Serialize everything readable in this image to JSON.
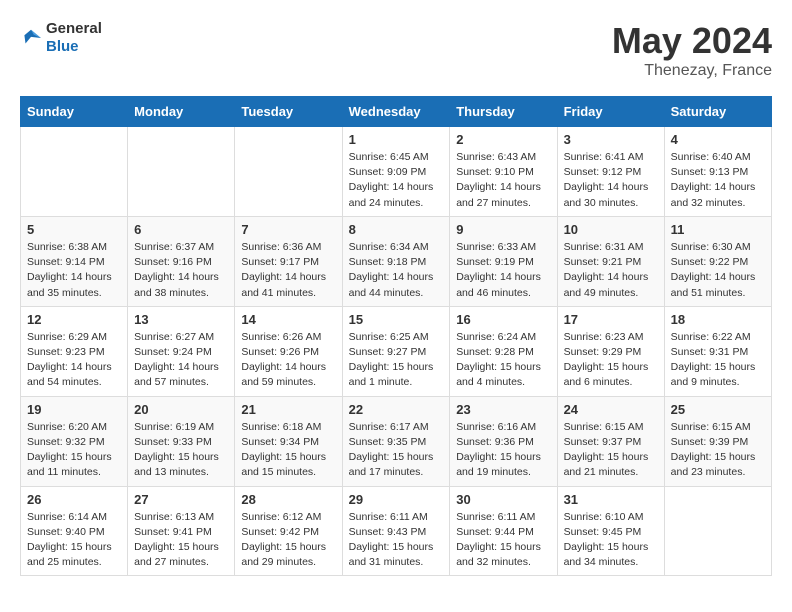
{
  "header": {
    "logo_general": "General",
    "logo_blue": "Blue",
    "title": "May 2024",
    "location": "Thenezay, France"
  },
  "weekdays": [
    "Sunday",
    "Monday",
    "Tuesday",
    "Wednesday",
    "Thursday",
    "Friday",
    "Saturday"
  ],
  "weeks": [
    [
      {
        "day": "",
        "info": ""
      },
      {
        "day": "",
        "info": ""
      },
      {
        "day": "",
        "info": ""
      },
      {
        "day": "1",
        "info": "Sunrise: 6:45 AM\nSunset: 9:09 PM\nDaylight: 14 hours and 24 minutes."
      },
      {
        "day": "2",
        "info": "Sunrise: 6:43 AM\nSunset: 9:10 PM\nDaylight: 14 hours and 27 minutes."
      },
      {
        "day": "3",
        "info": "Sunrise: 6:41 AM\nSunset: 9:12 PM\nDaylight: 14 hours and 30 minutes."
      },
      {
        "day": "4",
        "info": "Sunrise: 6:40 AM\nSunset: 9:13 PM\nDaylight: 14 hours and 32 minutes."
      }
    ],
    [
      {
        "day": "5",
        "info": "Sunrise: 6:38 AM\nSunset: 9:14 PM\nDaylight: 14 hours and 35 minutes."
      },
      {
        "day": "6",
        "info": "Sunrise: 6:37 AM\nSunset: 9:16 PM\nDaylight: 14 hours and 38 minutes."
      },
      {
        "day": "7",
        "info": "Sunrise: 6:36 AM\nSunset: 9:17 PM\nDaylight: 14 hours and 41 minutes."
      },
      {
        "day": "8",
        "info": "Sunrise: 6:34 AM\nSunset: 9:18 PM\nDaylight: 14 hours and 44 minutes."
      },
      {
        "day": "9",
        "info": "Sunrise: 6:33 AM\nSunset: 9:19 PM\nDaylight: 14 hours and 46 minutes."
      },
      {
        "day": "10",
        "info": "Sunrise: 6:31 AM\nSunset: 9:21 PM\nDaylight: 14 hours and 49 minutes."
      },
      {
        "day": "11",
        "info": "Sunrise: 6:30 AM\nSunset: 9:22 PM\nDaylight: 14 hours and 51 minutes."
      }
    ],
    [
      {
        "day": "12",
        "info": "Sunrise: 6:29 AM\nSunset: 9:23 PM\nDaylight: 14 hours and 54 minutes."
      },
      {
        "day": "13",
        "info": "Sunrise: 6:27 AM\nSunset: 9:24 PM\nDaylight: 14 hours and 57 minutes."
      },
      {
        "day": "14",
        "info": "Sunrise: 6:26 AM\nSunset: 9:26 PM\nDaylight: 14 hours and 59 minutes."
      },
      {
        "day": "15",
        "info": "Sunrise: 6:25 AM\nSunset: 9:27 PM\nDaylight: 15 hours and 1 minute."
      },
      {
        "day": "16",
        "info": "Sunrise: 6:24 AM\nSunset: 9:28 PM\nDaylight: 15 hours and 4 minutes."
      },
      {
        "day": "17",
        "info": "Sunrise: 6:23 AM\nSunset: 9:29 PM\nDaylight: 15 hours and 6 minutes."
      },
      {
        "day": "18",
        "info": "Sunrise: 6:22 AM\nSunset: 9:31 PM\nDaylight: 15 hours and 9 minutes."
      }
    ],
    [
      {
        "day": "19",
        "info": "Sunrise: 6:20 AM\nSunset: 9:32 PM\nDaylight: 15 hours and 11 minutes."
      },
      {
        "day": "20",
        "info": "Sunrise: 6:19 AM\nSunset: 9:33 PM\nDaylight: 15 hours and 13 minutes."
      },
      {
        "day": "21",
        "info": "Sunrise: 6:18 AM\nSunset: 9:34 PM\nDaylight: 15 hours and 15 minutes."
      },
      {
        "day": "22",
        "info": "Sunrise: 6:17 AM\nSunset: 9:35 PM\nDaylight: 15 hours and 17 minutes."
      },
      {
        "day": "23",
        "info": "Sunrise: 6:16 AM\nSunset: 9:36 PM\nDaylight: 15 hours and 19 minutes."
      },
      {
        "day": "24",
        "info": "Sunrise: 6:15 AM\nSunset: 9:37 PM\nDaylight: 15 hours and 21 minutes."
      },
      {
        "day": "25",
        "info": "Sunrise: 6:15 AM\nSunset: 9:39 PM\nDaylight: 15 hours and 23 minutes."
      }
    ],
    [
      {
        "day": "26",
        "info": "Sunrise: 6:14 AM\nSunset: 9:40 PM\nDaylight: 15 hours and 25 minutes."
      },
      {
        "day": "27",
        "info": "Sunrise: 6:13 AM\nSunset: 9:41 PM\nDaylight: 15 hours and 27 minutes."
      },
      {
        "day": "28",
        "info": "Sunrise: 6:12 AM\nSunset: 9:42 PM\nDaylight: 15 hours and 29 minutes."
      },
      {
        "day": "29",
        "info": "Sunrise: 6:11 AM\nSunset: 9:43 PM\nDaylight: 15 hours and 31 minutes."
      },
      {
        "day": "30",
        "info": "Sunrise: 6:11 AM\nSunset: 9:44 PM\nDaylight: 15 hours and 32 minutes."
      },
      {
        "day": "31",
        "info": "Sunrise: 6:10 AM\nSunset: 9:45 PM\nDaylight: 15 hours and 34 minutes."
      },
      {
        "day": "",
        "info": ""
      }
    ]
  ]
}
